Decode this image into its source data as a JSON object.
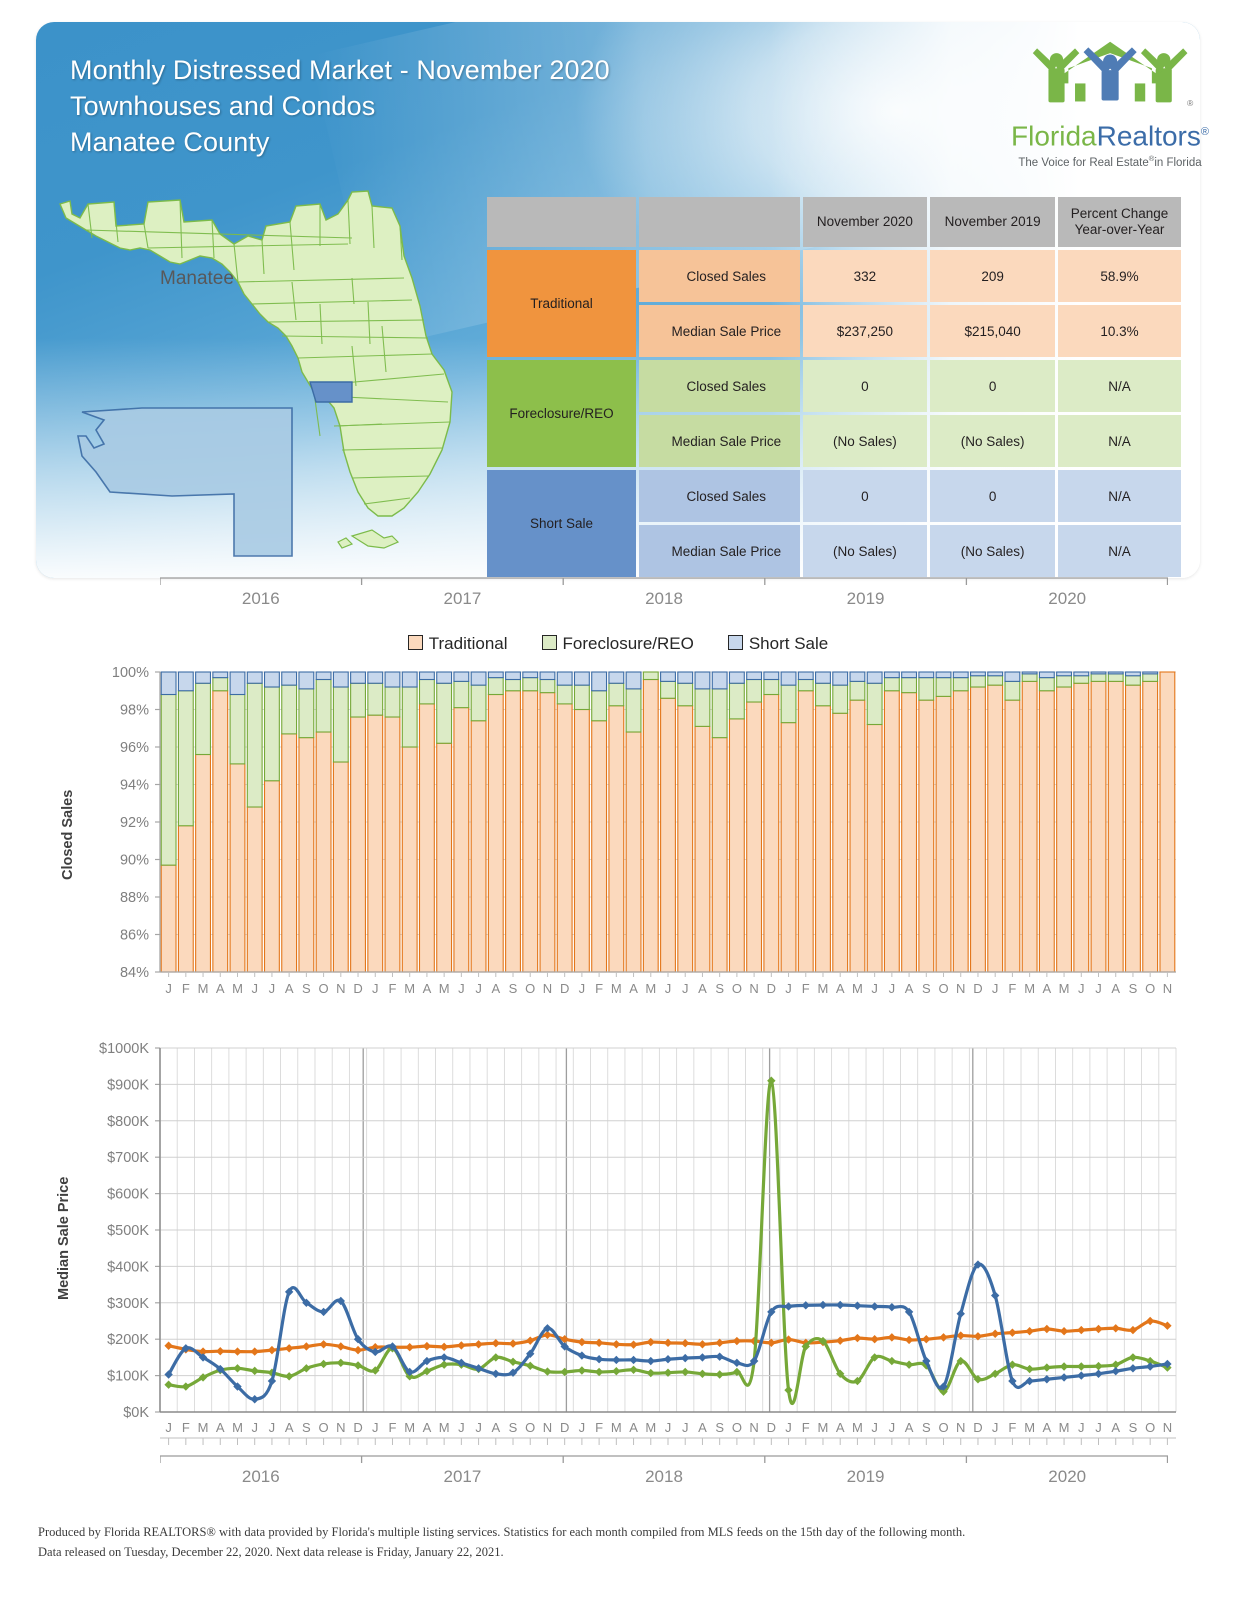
{
  "header": {
    "title_line1": "Monthly Distressed Market - November 2020",
    "title_line2": "Townhouses and Condos",
    "title_line3": "Manatee County"
  },
  "logo": {
    "name_part1": "Florida",
    "name_part2": "Realtors",
    "registered": "®",
    "tagline_pre": "The Voice for Real Estate",
    "tagline_sup": "®",
    "tagline_post": "in Florida",
    "mark_icon": "family-house-icon"
  },
  "map": {
    "county_label": "Manatee",
    "state_icon": "florida-state-map-icon",
    "highlight_color": "#6691c9",
    "state_fill": "#ddf0c2",
    "state_stroke": "#7cbb4a"
  },
  "table": {
    "columns": [
      "",
      "",
      "November 2020",
      "November 2019",
      "Percent Change\nYear-over-Year"
    ],
    "col_header_current": "November 2020",
    "col_header_prior": "November 2019",
    "col_header_change_l1": "Percent Change",
    "col_header_change_l2": "Year-over-Year",
    "groups": [
      {
        "name": "Traditional",
        "color": "#f0943e",
        "rows": [
          {
            "metric": "Closed Sales",
            "current": "332",
            "prior": "209",
            "change": "58.9%"
          },
          {
            "metric": "Median Sale Price",
            "current": "$237,250",
            "prior": "$215,040",
            "change": "10.3%"
          }
        ]
      },
      {
        "name": "Foreclosure/REO",
        "color": "#8dbf4b",
        "rows": [
          {
            "metric": "Closed Sales",
            "current": "0",
            "prior": "0",
            "change": "N/A"
          },
          {
            "metric": "Median Sale Price",
            "current": "(No Sales)",
            "prior": "(No Sales)",
            "change": "N/A"
          }
        ]
      },
      {
        "name": "Short Sale",
        "color": "#6691c9",
        "rows": [
          {
            "metric": "Closed Sales",
            "current": "0",
            "prior": "0",
            "change": "N/A"
          },
          {
            "metric": "Median Sale Price",
            "current": "(No Sales)",
            "prior": "(No Sales)",
            "change": "N/A"
          }
        ]
      }
    ]
  },
  "legend": {
    "items": [
      {
        "label": "Traditional",
        "color": "#fbd9bd",
        "border": "#e3761a"
      },
      {
        "label": "Foreclosure/REO",
        "color": "#dcebc6",
        "border": "#76a838"
      },
      {
        "label": "Short Sale",
        "color": "#c7d7ec",
        "border": "#3c6ca5"
      }
    ]
  },
  "years": [
    "2016",
    "2017",
    "2018",
    "2019",
    "2020"
  ],
  "chart_data": [
    {
      "type": "bar",
      "stacked": true,
      "percent_stacked": true,
      "title": "",
      "ylabel": "Closed Sales",
      "xlabel": "",
      "ylim": [
        84,
        100
      ],
      "yticks": [
        "84%",
        "86%",
        "88%",
        "90%",
        "92%",
        "94%",
        "96%",
        "98%",
        "100%"
      ],
      "grid": true,
      "legend_position": "top",
      "month_labels": [
        "J",
        "F",
        "M",
        "A",
        "M",
        "J",
        "J",
        "A",
        "S",
        "O",
        "N",
        "D"
      ],
      "x": [
        "Jan 2016",
        "Feb 2016",
        "Mar 2016",
        "Apr 2016",
        "May 2016",
        "Jun 2016",
        "Jul 2016",
        "Aug 2016",
        "Sep 2016",
        "Oct 2016",
        "Nov 2016",
        "Dec 2016",
        "Jan 2017",
        "Feb 2017",
        "Mar 2017",
        "Apr 2017",
        "May 2017",
        "Jun 2017",
        "Jul 2017",
        "Aug 2017",
        "Sep 2017",
        "Oct 2017",
        "Nov 2017",
        "Dec 2017",
        "Jan 2018",
        "Feb 2018",
        "Mar 2018",
        "Apr 2018",
        "May 2018",
        "Jun 2018",
        "Jul 2018",
        "Aug 2018",
        "Sep 2018",
        "Oct 2018",
        "Nov 2018",
        "Dec 2018",
        "Jan 2019",
        "Feb 2019",
        "Mar 2019",
        "Apr 2019",
        "May 2019",
        "Jun 2019",
        "Jul 2019",
        "Aug 2019",
        "Sep 2019",
        "Oct 2019",
        "Nov 2019",
        "Dec 2019",
        "Jan 2020",
        "Feb 2020",
        "Mar 2020",
        "Apr 2020",
        "May 2020",
        "Jun 2020",
        "Jul 2020",
        "Aug 2020",
        "Sep 2020",
        "Oct 2020",
        "Nov 2020"
      ],
      "series": [
        {
          "name": "Traditional",
          "color": "#fbd9bd",
          "border": "#e3761a",
          "values": [
            89.7,
            91.8,
            95.6,
            99.0,
            95.1,
            92.8,
            94.2,
            96.7,
            96.5,
            96.8,
            95.2,
            97.6,
            97.7,
            97.6,
            96.0,
            98.3,
            96.2,
            98.1,
            97.4,
            98.8,
            99.0,
            99.0,
            98.9,
            98.3,
            98.0,
            97.4,
            98.2,
            96.8,
            99.6,
            98.6,
            98.2,
            97.1,
            96.5,
            97.5,
            98.4,
            98.8,
            97.3,
            99.0,
            98.2,
            97.8,
            98.5,
            97.2,
            99.0,
            98.9,
            98.5,
            98.7,
            99.0,
            99.2,
            99.3,
            98.5,
            99.5,
            99.0,
            99.2,
            99.4,
            99.5,
            99.5,
            99.3,
            99.5,
            100.0
          ]
        },
        {
          "name": "Foreclosure/REO",
          "color": "#dcebc6",
          "border": "#76a838",
          "values": [
            9.1,
            7.2,
            3.8,
            0.7,
            3.7,
            6.6,
            5.0,
            2.6,
            2.6,
            2.8,
            4.0,
            1.8,
            1.7,
            1.6,
            3.2,
            1.3,
            3.2,
            1.4,
            1.9,
            0.9,
            0.6,
            0.7,
            0.7,
            1.0,
            1.3,
            1.6,
            1.2,
            2.3,
            0.4,
            0.9,
            1.2,
            2.0,
            2.6,
            1.9,
            1.2,
            0.8,
            2.0,
            0.6,
            1.2,
            1.5,
            1.0,
            2.2,
            0.7,
            0.8,
            1.2,
            1.0,
            0.7,
            0.6,
            0.5,
            1.0,
            0.4,
            0.7,
            0.6,
            0.4,
            0.4,
            0.4,
            0.5,
            0.4,
            0.0
          ]
        },
        {
          "name": "Short Sale",
          "color": "#c7d7ec",
          "border": "#3c6ca5",
          "values": [
            1.2,
            1.0,
            0.6,
            0.3,
            1.2,
            0.6,
            0.8,
            0.7,
            0.9,
            0.4,
            0.8,
            0.6,
            0.6,
            0.8,
            0.8,
            0.4,
            0.6,
            0.5,
            0.7,
            0.3,
            0.4,
            0.3,
            0.4,
            0.7,
            0.7,
            1.0,
            0.6,
            0.9,
            0.0,
            0.5,
            0.6,
            0.9,
            0.9,
            0.6,
            0.4,
            0.4,
            0.7,
            0.4,
            0.6,
            0.7,
            0.5,
            0.6,
            0.3,
            0.3,
            0.3,
            0.3,
            0.3,
            0.2,
            0.2,
            0.5,
            0.1,
            0.3,
            0.2,
            0.2,
            0.1,
            0.1,
            0.2,
            0.1,
            0.0
          ]
        }
      ]
    },
    {
      "type": "line",
      "title": "",
      "ylabel": "Median Sale Price",
      "xlabel": "",
      "ylim": [
        0,
        1000
      ],
      "yticks": [
        "$0K",
        "$100K",
        "$200K",
        "$300K",
        "$400K",
        "$500K",
        "$600K",
        "$700K",
        "$800K",
        "$900K",
        "$1000K"
      ],
      "grid": true,
      "legend_position": "top",
      "units": "thousands of dollars",
      "month_labels": [
        "J",
        "F",
        "M",
        "A",
        "M",
        "J",
        "J",
        "A",
        "S",
        "O",
        "N",
        "D"
      ],
      "x": [
        "Jan 2016",
        "Feb 2016",
        "Mar 2016",
        "Apr 2016",
        "May 2016",
        "Jun 2016",
        "Jul 2016",
        "Aug 2016",
        "Sep 2016",
        "Oct 2016",
        "Nov 2016",
        "Dec 2016",
        "Jan 2017",
        "Feb 2017",
        "Mar 2017",
        "Apr 2017",
        "May 2017",
        "Jun 2017",
        "Jul 2017",
        "Aug 2017",
        "Sep 2017",
        "Oct 2017",
        "Nov 2017",
        "Dec 2017",
        "Jan 2018",
        "Feb 2018",
        "Mar 2018",
        "Apr 2018",
        "May 2018",
        "Jun 2018",
        "Jul 2018",
        "Aug 2018",
        "Sep 2018",
        "Oct 2018",
        "Nov 2018",
        "Dec 2018",
        "Jan 2019",
        "Feb 2019",
        "Mar 2019",
        "Apr 2019",
        "May 2019",
        "Jun 2019",
        "Jul 2019",
        "Aug 2019",
        "Sep 2019",
        "Oct 2019",
        "Nov 2019",
        "Dec 2019",
        "Jan 2020",
        "Feb 2020",
        "Mar 2020",
        "Apr 2020",
        "May 2020",
        "Jun 2020",
        "Jul 2020",
        "Aug 2020",
        "Sep 2020",
        "Oct 2020",
        "Nov 2020"
      ],
      "series": [
        {
          "name": "Traditional",
          "color": "#e3761a",
          "values": [
            182,
            172,
            166,
            167,
            166,
            166,
            170,
            175,
            180,
            186,
            180,
            170,
            178,
            178,
            178,
            181,
            179,
            183,
            186,
            189,
            188,
            196,
            212,
            200,
            192,
            190,
            186,
            185,
            192,
            190,
            189,
            186,
            190,
            195,
            195,
            190,
            199,
            190,
            192,
            196,
            203,
            200,
            205,
            198,
            200,
            205,
            210,
            208,
            215,
            218,
            222,
            228,
            222,
            225,
            228,
            230,
            225,
            250,
            237
          ]
        },
        {
          "name": "Foreclosure/REO",
          "color": "#76a838",
          "values": [
            75,
            70,
            95,
            115,
            120,
            113,
            108,
            98,
            120,
            132,
            135,
            128,
            114,
            175,
            98,
            112,
            130,
            130,
            118,
            150,
            138,
            127,
            111,
            110,
            114,
            110,
            112,
            116,
            107,
            108,
            110,
            105,
            103,
            110,
            140,
            910,
            60,
            180,
            195,
            105,
            85,
            150,
            140,
            130,
            128,
            56,
            140,
            90,
            105,
            130,
            118,
            122,
            125,
            125,
            126,
            130,
            150,
            140,
            122
          ]
        },
        {
          "name": "Short Sale",
          "color": "#3c6ca5",
          "values": [
            103,
            175,
            150,
            118,
            70,
            35,
            85,
            330,
            300,
            275,
            305,
            200,
            165,
            180,
            110,
            140,
            150,
            135,
            120,
            105,
            108,
            160,
            230,
            180,
            155,
            145,
            143,
            143,
            140,
            145,
            148,
            150,
            152,
            135,
            140,
            275,
            290,
            293,
            294,
            294,
            292,
            290,
            288,
            275,
            140,
            70,
            270,
            405,
            320,
            85,
            85,
            90,
            95,
            100,
            105,
            112,
            120,
            125,
            132
          ]
        }
      ]
    }
  ],
  "footer": {
    "line1": "Produced by Florida REALTORS® with data provided by Florida's multiple listing services. Statistics for each month compiled from MLS feeds on the 15th day of the following month.",
    "line2": "Data released on Tuesday, December 22, 2020. Next data release is Friday, January 22, 2021."
  }
}
